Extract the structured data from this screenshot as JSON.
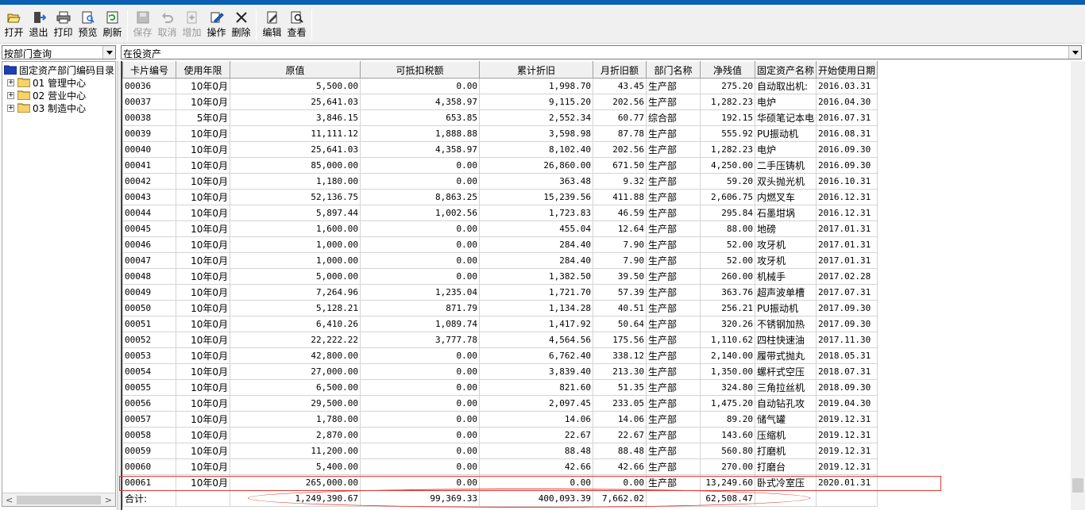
{
  "toolbar": {
    "open": "打开",
    "exit": "退出",
    "print": "打印",
    "preview": "预览",
    "refresh": "刷新",
    "save": "保存",
    "cancel": "取消",
    "add": "增加",
    "operate": "操作",
    "delete": "删除",
    "edit": "编辑",
    "view": "查看"
  },
  "left_combo": {
    "value": "按部门查询"
  },
  "right_combo": {
    "value": "在役资产"
  },
  "tree": {
    "root": "固定资产部门编码目录",
    "items": [
      {
        "label": "01 管理中心"
      },
      {
        "label": "02 营业中心"
      },
      {
        "label": "03 制造中心"
      }
    ]
  },
  "grid": {
    "columns": [
      "卡片编号",
      "使用年限",
      "原值",
      "可抵扣税额",
      "累计折旧",
      "月折旧额",
      "部门名称",
      "净残值",
      "固定资产名称",
      "开始使用日期"
    ],
    "rows": [
      [
        "00036",
        "10年0月",
        "5,500.00",
        "0.00",
        "1,998.70",
        "43.45",
        "生产部",
        "275.20",
        "自动取出机:",
        "2016.03.31"
      ],
      [
        "00037",
        "10年0月",
        "25,641.03",
        "4,358.97",
        "9,115.20",
        "202.56",
        "生产部",
        "1,282.23",
        "电炉",
        "2016.04.30"
      ],
      [
        "00038",
        "5年0月",
        "3,846.15",
        "653.85",
        "2,552.34",
        "60.77",
        "综合部",
        "192.15",
        "华硕笔记本电",
        "2016.07.31"
      ],
      [
        "00039",
        "10年0月",
        "11,111.12",
        "1,888.88",
        "3,598.98",
        "87.78",
        "生产部",
        "555.92",
        "PU振动机",
        "2016.08.31"
      ],
      [
        "00040",
        "10年0月",
        "25,641.03",
        "4,358.97",
        "8,102.40",
        "202.56",
        "生产部",
        "1,282.23",
        "电炉",
        "2016.09.30"
      ],
      [
        "00041",
        "10年0月",
        "85,000.00",
        "0.00",
        "26,860.00",
        "671.50",
        "生产部",
        "4,250.00",
        "二手压铸机",
        "2016.09.30"
      ],
      [
        "00042",
        "10年0月",
        "1,180.00",
        "0.00",
        "363.48",
        "9.32",
        "生产部",
        "59.20",
        "双头抛光机",
        "2016.10.31"
      ],
      [
        "00043",
        "10年0月",
        "52,136.75",
        "8,863.25",
        "15,239.56",
        "411.88",
        "生产部",
        "2,606.75",
        "内燃叉车",
        "2016.12.31"
      ],
      [
        "00044",
        "10年0月",
        "5,897.44",
        "1,002.56",
        "1,723.83",
        "46.59",
        "生产部",
        "295.84",
        "石墨坩埚",
        "2016.12.31"
      ],
      [
        "00045",
        "10年0月",
        "1,600.00",
        "0.00",
        "455.04",
        "12.64",
        "生产部",
        "88.00",
        "地磅",
        "2017.01.31"
      ],
      [
        "00046",
        "10年0月",
        "1,000.00",
        "0.00",
        "284.40",
        "7.90",
        "生产部",
        "52.00",
        "攻牙机",
        "2017.01.31"
      ],
      [
        "00047",
        "10年0月",
        "1,000.00",
        "0.00",
        "284.40",
        "7.90",
        "生产部",
        "52.00",
        "攻牙机",
        "2017.01.31"
      ],
      [
        "00048",
        "10年0月",
        "5,000.00",
        "0.00",
        "1,382.50",
        "39.50",
        "生产部",
        "260.00",
        "机械手",
        "2017.02.28"
      ],
      [
        "00049",
        "10年0月",
        "7,264.96",
        "1,235.04",
        "1,721.70",
        "57.39",
        "生产部",
        "363.76",
        "超声波单槽",
        "2017.07.31"
      ],
      [
        "00050",
        "10年0月",
        "5,128.21",
        "871.79",
        "1,134.28",
        "40.51",
        "生产部",
        "256.21",
        "PU振动机",
        "2017.09.30"
      ],
      [
        "00051",
        "10年0月",
        "6,410.26",
        "1,089.74",
        "1,417.92",
        "50.64",
        "生产部",
        "320.26",
        "不锈钢加热",
        "2017.09.30"
      ],
      [
        "00052",
        "10年0月",
        "22,222.22",
        "3,777.78",
        "4,564.56",
        "175.56",
        "生产部",
        "1,110.62",
        "四柱快速油",
        "2017.11.30"
      ],
      [
        "00053",
        "10年0月",
        "42,800.00",
        "0.00",
        "6,762.40",
        "338.12",
        "生产部",
        "2,140.00",
        "履带式抛丸",
        "2018.05.31"
      ],
      [
        "00054",
        "10年0月",
        "27,000.00",
        "0.00",
        "3,839.40",
        "213.30",
        "生产部",
        "1,350.00",
        "螺杆式空压",
        "2018.07.31"
      ],
      [
        "00055",
        "10年0月",
        "6,500.00",
        "0.00",
        "821.60",
        "51.35",
        "生产部",
        "324.80",
        "三角拉丝机",
        "2018.09.30"
      ],
      [
        "00056",
        "10年0月",
        "29,500.00",
        "0.00",
        "2,097.45",
        "233.05",
        "生产部",
        "1,475.20",
        "自动钻孔攻",
        "2019.04.30"
      ],
      [
        "00057",
        "10年0月",
        "1,780.00",
        "0.00",
        "14.06",
        "14.06",
        "生产部",
        "89.20",
        "储气罐",
        "2019.12.31"
      ],
      [
        "00058",
        "10年0月",
        "2,870.00",
        "0.00",
        "22.67",
        "22.67",
        "生产部",
        "143.60",
        "压缩机",
        "2019.12.31"
      ],
      [
        "00059",
        "10年0月",
        "11,200.00",
        "0.00",
        "88.48",
        "88.48",
        "生产部",
        "560.80",
        "打磨机",
        "2019.12.31"
      ],
      [
        "00060",
        "10年0月",
        "5,400.00",
        "0.00",
        "42.66",
        "42.66",
        "生产部",
        "270.00",
        "打磨台",
        "2019.12.31"
      ],
      [
        "00061",
        "10年0月",
        "265,000.00",
        "0.00",
        "0.00",
        "0.00",
        "生产部",
        "13,249.60",
        "卧式冷室压",
        "2020.01.31"
      ]
    ],
    "total": [
      "合计:",
      "",
      "1,249,390.67",
      "99,369.33",
      "400,093.39",
      "7,662.02",
      "",
      "62,508.47",
      "",
      ""
    ]
  },
  "colors": {
    "annotation": "#e53935",
    "titlebar": "#0a5fb4",
    "folder": "#f4d36b"
  }
}
